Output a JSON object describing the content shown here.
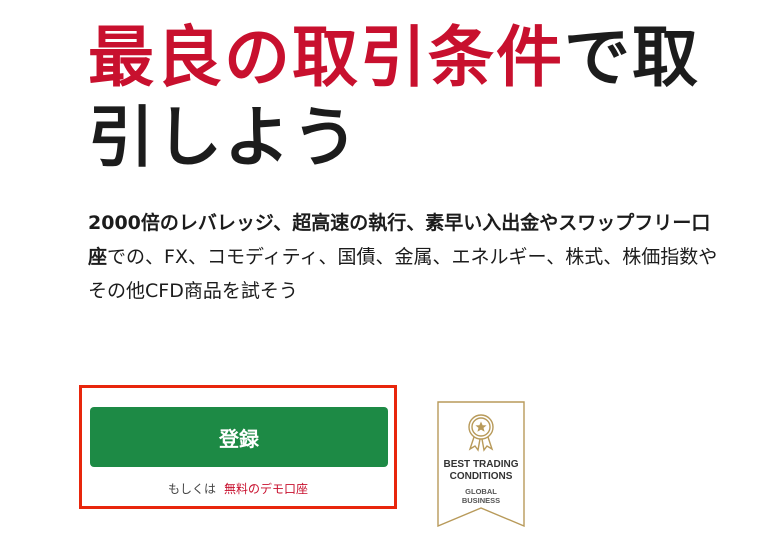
{
  "hero": {
    "headline_accent": "最良の取引条件",
    "headline_rest": "で取引しよう",
    "subtext_strong": "2000倍のレバレッジ、超高速の執行、素早い入出金やスワップフリー口座",
    "subtext_rest": "での、FX、コモディティ、国債、金属、エネルギー、株式、株価指数やその他CFD商品を試そう"
  },
  "cta": {
    "register_label": "登録",
    "or_text": "もしくは",
    "demo_link_label": "無料のデモ口座"
  },
  "award": {
    "title_line1": "BEST TRADING",
    "title_line2": "CONDITIONS",
    "sub_line1": "GLOBAL",
    "sub_line2": "BUSINESS"
  },
  "colors": {
    "accent_red": "#c8102e",
    "button_green": "#1d8a45",
    "highlight_border": "#e8260c",
    "award_gold": "#b89a5a"
  }
}
